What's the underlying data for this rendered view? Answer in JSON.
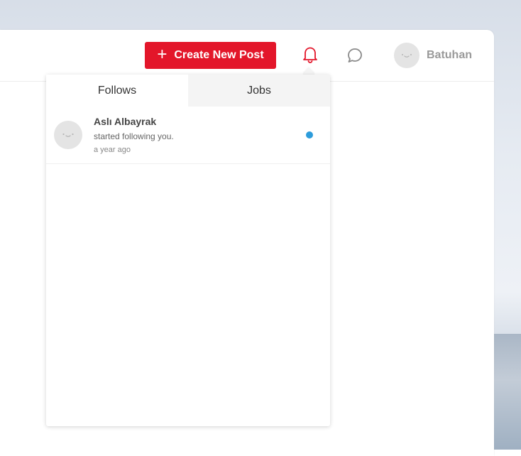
{
  "header": {
    "create_label": "Create New Post",
    "create_plus": "+",
    "user_name": "Batuhan"
  },
  "icons": {
    "bell": "bell-icon",
    "chat": "chat-bubble-icon",
    "plus": "plus-icon",
    "avatar": "avatar-placeholder-icon"
  },
  "notifications": {
    "tabs": [
      {
        "label": "Follows",
        "active": true
      },
      {
        "label": "Jobs",
        "active": false
      }
    ],
    "items": [
      {
        "name": "Aslı Albayrak",
        "text": "started following you.",
        "time": "a year ago",
        "unread": true
      }
    ]
  },
  "colors": {
    "accent": "#e3162a",
    "unread_dot": "#2d9cdb",
    "inactive_tab": "#f4f4f4"
  }
}
